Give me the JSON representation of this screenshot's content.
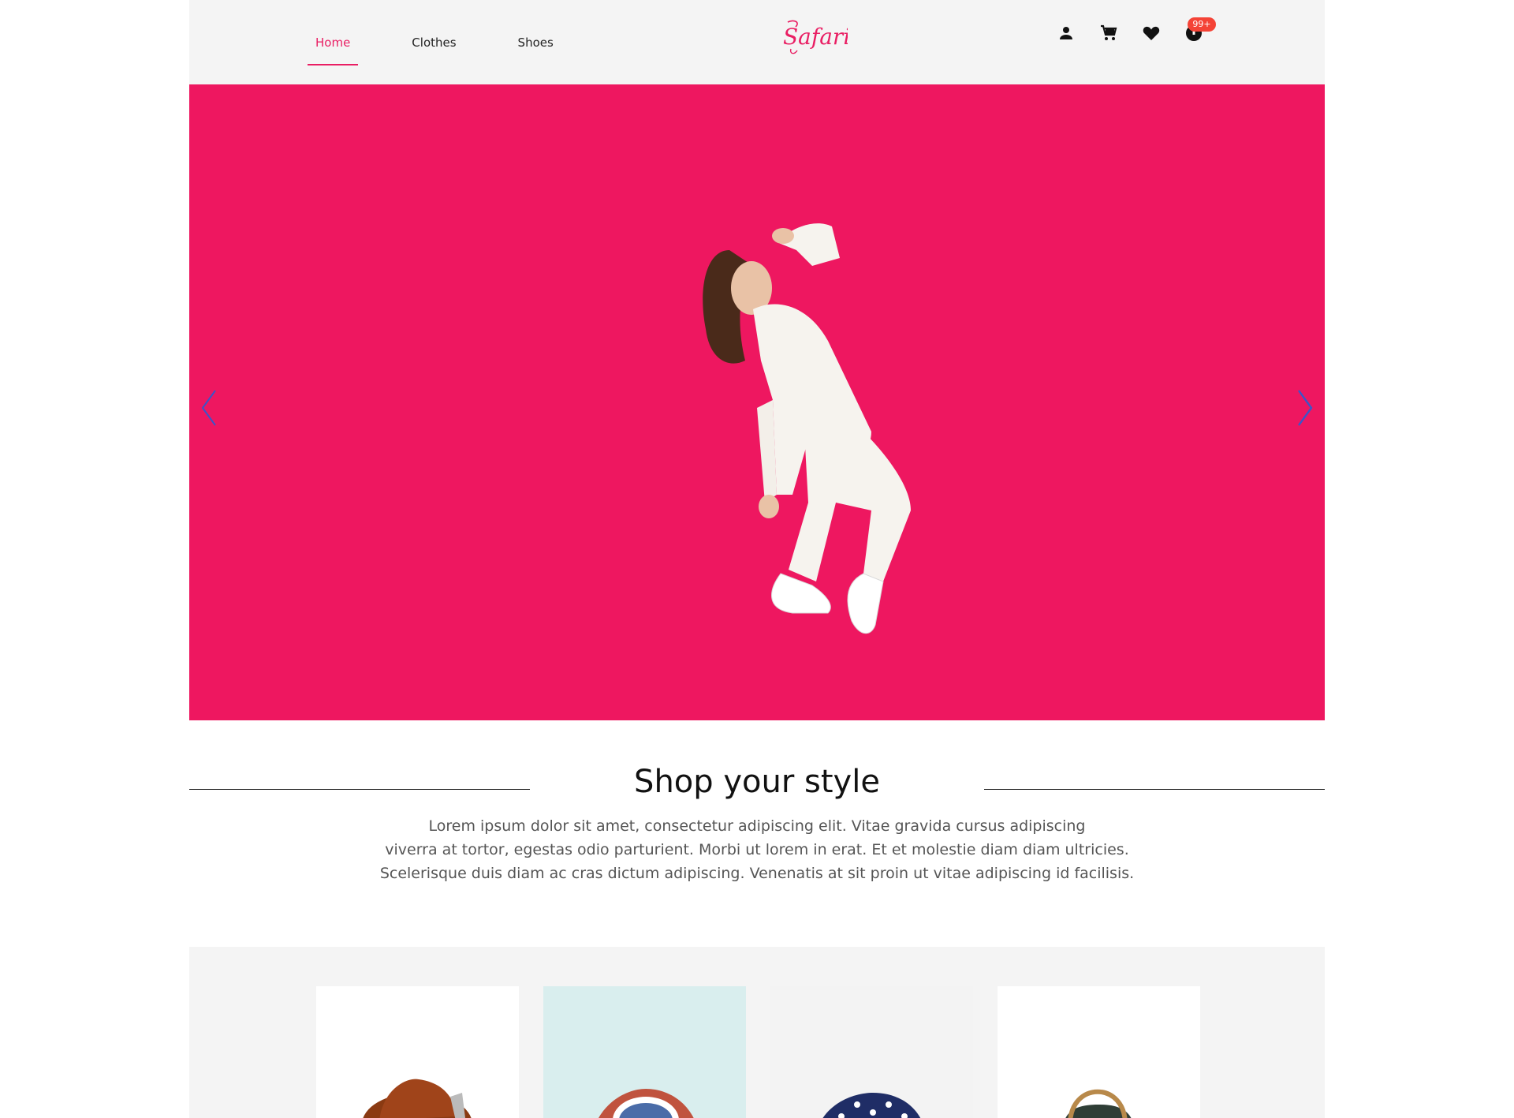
{
  "nav": {
    "items": [
      {
        "label": "Home",
        "active": true
      },
      {
        "label": "Clothes",
        "active": false
      },
      {
        "label": "Shoes",
        "active": false
      }
    ]
  },
  "brand": {
    "logo_text": "Safari",
    "accent_color": "#e91e63"
  },
  "header_icons": {
    "user": "person-icon",
    "cart": "cart-icon",
    "wishlist": "heart-icon",
    "notifications": "notification-icon",
    "badge": "99+"
  },
  "hero": {
    "background": "#ee1760",
    "prev_icon": "chevron-left-icon",
    "next_icon": "chevron-right-icon"
  },
  "section": {
    "title": "Shop your style",
    "description_lines": [
      "Lorem ipsum dolor sit amet, consectetur adipiscing elit. Vitae gravida cursus adipiscing",
      "viverra at tortor, egestas odio parturient. Morbi ut lorem in erat. Et et molestie diam diam ultricies.",
      "Scelerisque duis diam ac cras dictum adipiscing. Venenatis at sit proin ut vitae adipiscing id facilisis."
    ]
  },
  "products": [
    {
      "name": "hat"
    },
    {
      "name": "cap"
    },
    {
      "name": "stars-cap"
    },
    {
      "name": "bag"
    }
  ]
}
